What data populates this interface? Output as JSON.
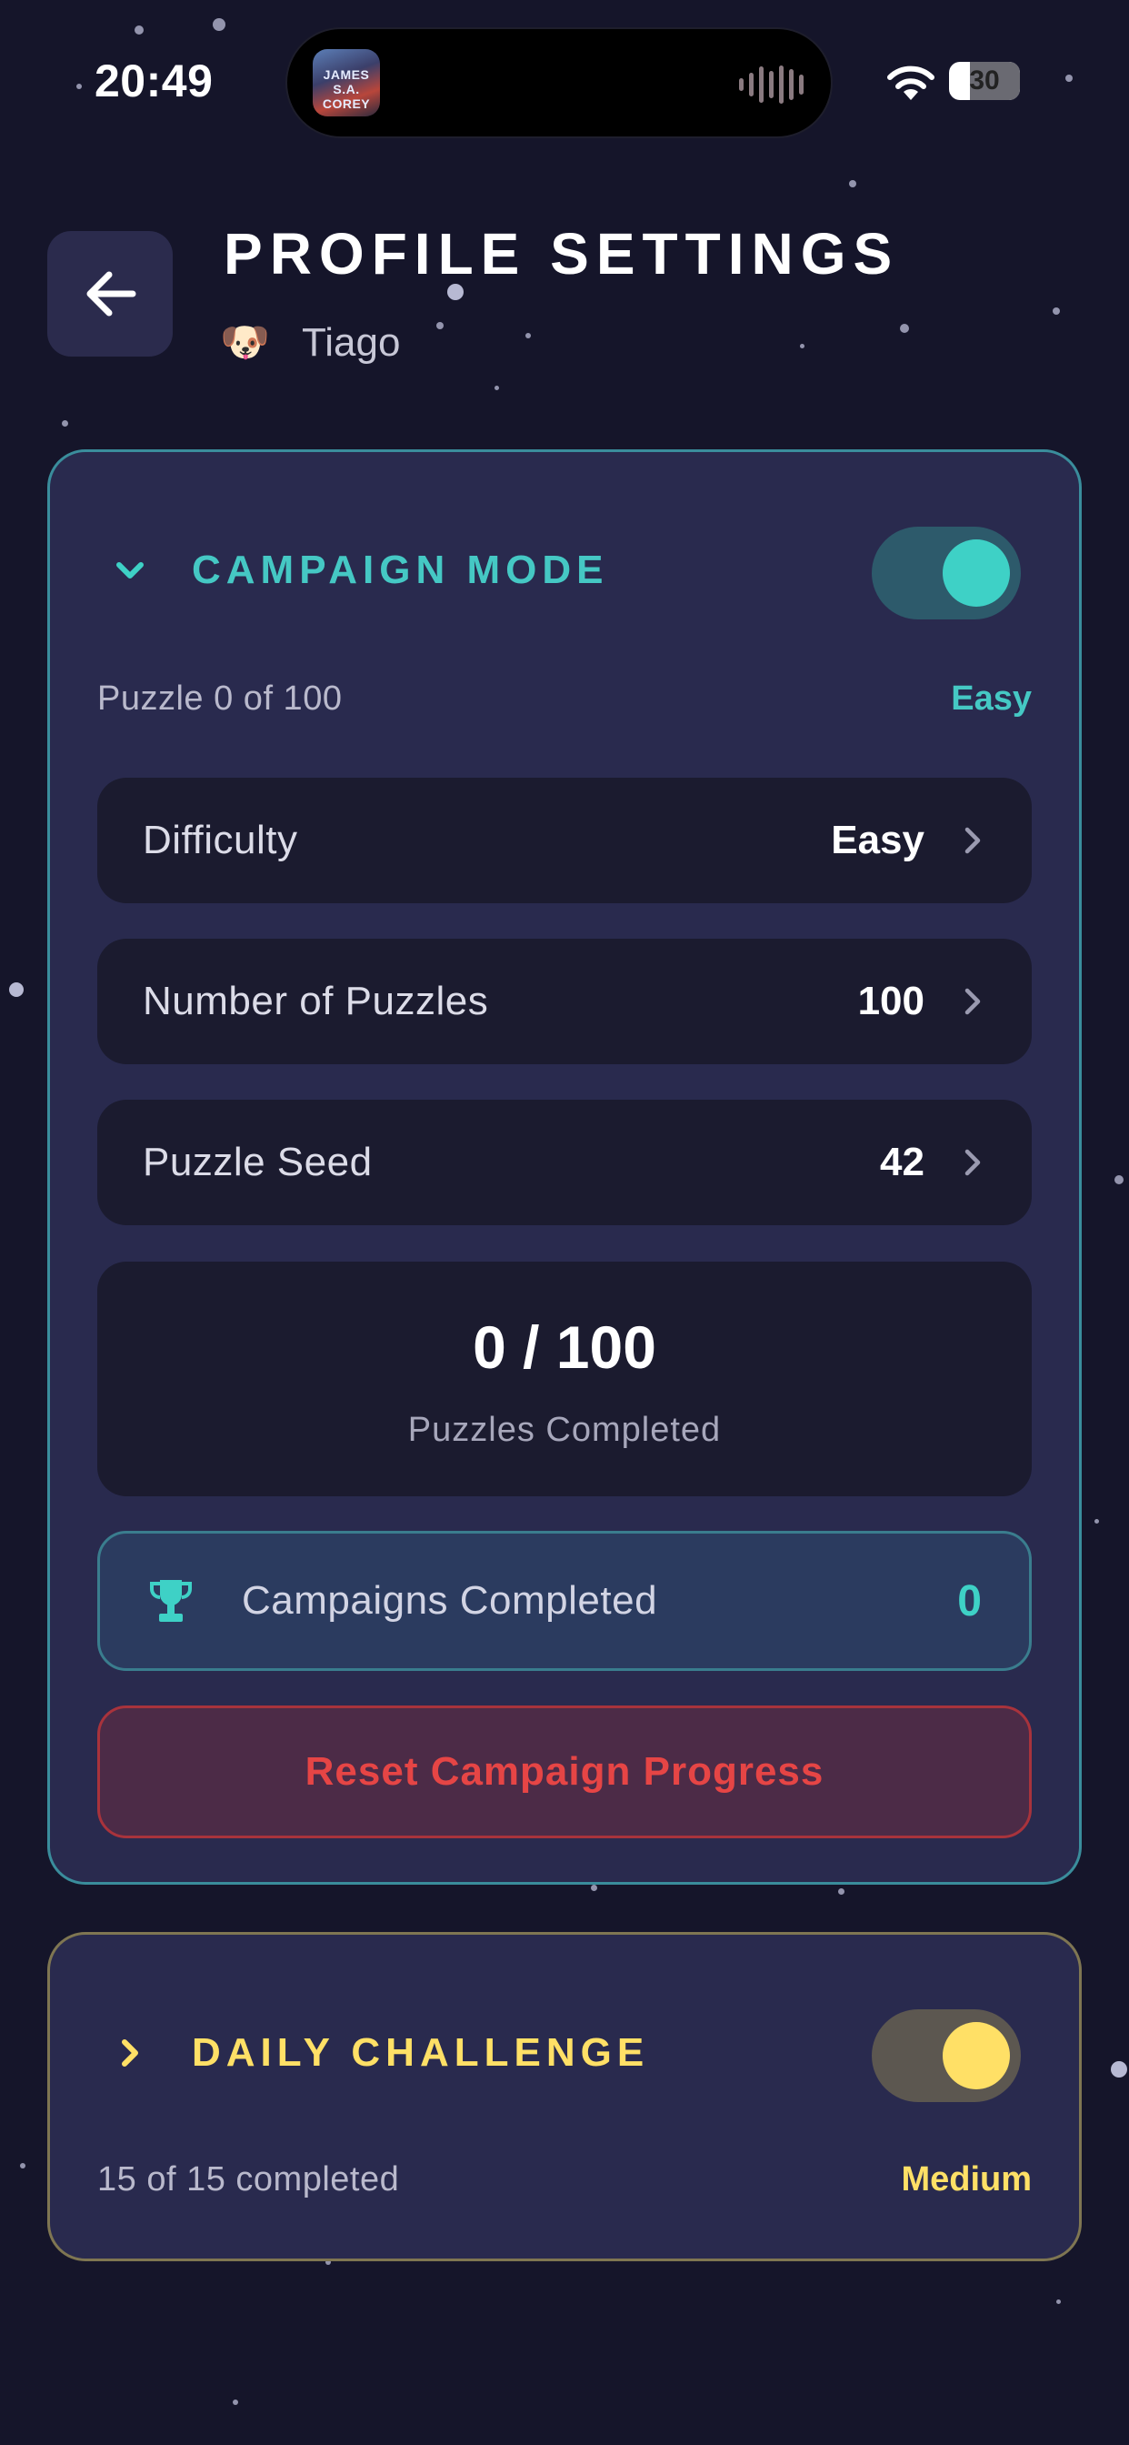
{
  "status_bar": {
    "time": "20:49",
    "now_playing_art_text": "JAMES S.A. COREY",
    "battery_percent": 30,
    "battery_label": "30"
  },
  "header": {
    "title": "PROFILE SETTINGS",
    "profile_name": "Tiago",
    "avatar_emoji": "🐶"
  },
  "campaign": {
    "title": "CAMPAIGN MODE",
    "enabled": true,
    "expanded": true,
    "summary_left": "Puzzle 0 of 100",
    "summary_right": "Easy",
    "settings": [
      {
        "label": "Difficulty",
        "value": "Easy"
      },
      {
        "label": "Number of Puzzles",
        "value": "100"
      },
      {
        "label": "Puzzle Seed",
        "value": "42"
      }
    ],
    "progress_value": "0 / 100",
    "progress_label": "Puzzles Completed",
    "campaigns_completed_label": "Campaigns Completed",
    "campaigns_completed_count": "0",
    "reset_label": "Reset Campaign Progress"
  },
  "daily": {
    "title": "DAILY CHALLENGE",
    "enabled": true,
    "expanded": false,
    "summary_left": "15 of 15 completed",
    "summary_right": "Medium"
  },
  "colors": {
    "background": "#15152a",
    "card": "#292a4e",
    "row": "#1b1b2f",
    "teal_accent": "#3ed1c6",
    "yellow_accent": "#ffe066",
    "danger": "#e64545"
  }
}
